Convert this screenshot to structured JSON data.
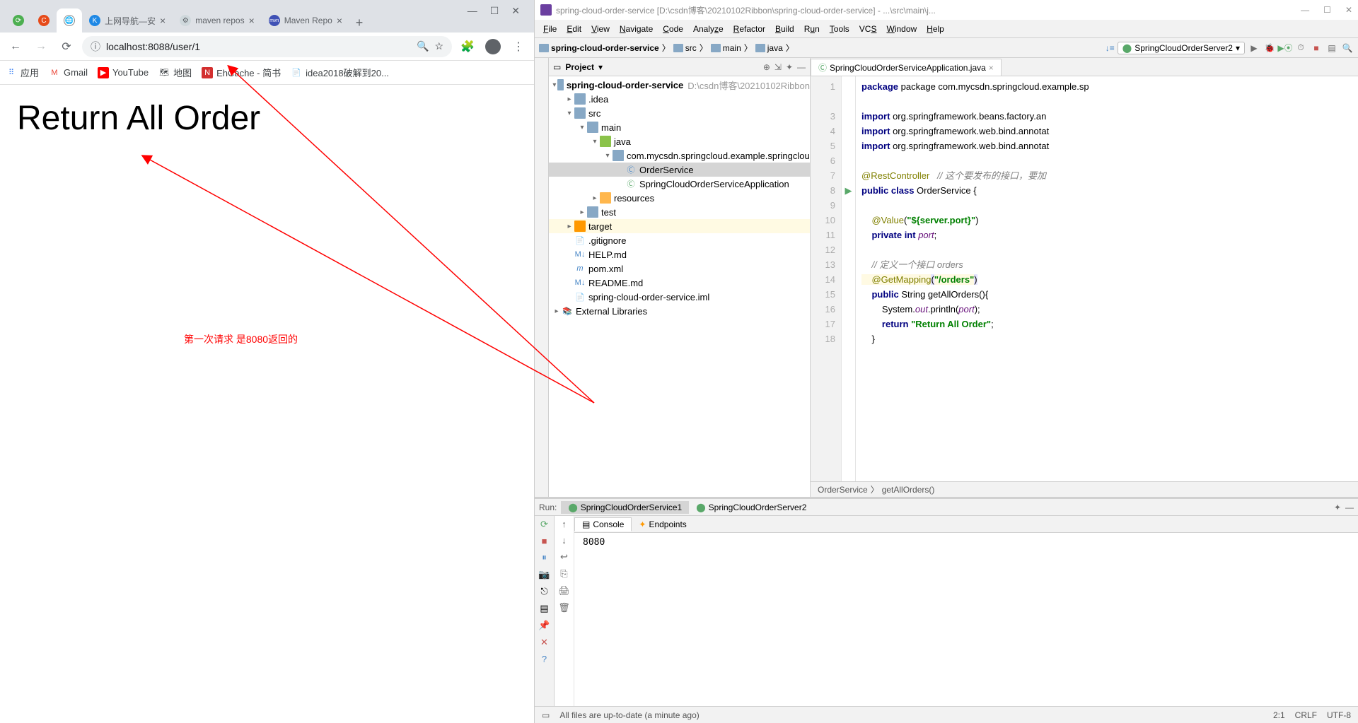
{
  "chrome": {
    "tabs": [
      {
        "label": "",
        "active": false,
        "favcolor": "#4caf50"
      },
      {
        "label": "",
        "active": false,
        "favcolor": "#e64a19",
        "text": "C"
      },
      {
        "label": "",
        "active": true
      },
      {
        "label": "上网导航—安",
        "favcolor": "#1e88e5",
        "text": "K"
      },
      {
        "label": "maven repos",
        "favcolor": "#9e9e9e"
      },
      {
        "label": "Maven Repo",
        "favcolor": "#3f51b5"
      }
    ],
    "url": "localhost:8088/user/1",
    "bookmarks": [
      {
        "label": "应用",
        "color": "#4285f4"
      },
      {
        "label": "Gmail",
        "color": "#ea4335",
        "text": "M"
      },
      {
        "label": "YouTube",
        "color": "#ff0000",
        "text": "▶"
      },
      {
        "label": "地图",
        "color": "#34a853"
      },
      {
        "label": "EhCache - 简书",
        "color": "#d32f2f",
        "text": "N"
      },
      {
        "label": "idea2018破解到20..."
      }
    ],
    "page_heading": "Return All Order",
    "annotation": "第一次请求 是8080返回的"
  },
  "ij": {
    "title": "spring-cloud-order-service [D:\\csdn博客\\20210102Ribbon\\spring-cloud-order-service] - ...\\src\\main\\j...",
    "menu": [
      "File",
      "Edit",
      "View",
      "Navigate",
      "Code",
      "Analyze",
      "Refactor",
      "Build",
      "Run",
      "Tools",
      "VCS",
      "Window",
      "Help"
    ],
    "crumbs": [
      "spring-cloud-order-service",
      "src",
      "main",
      "java"
    ],
    "run_config": "SpringCloudOrderServer2",
    "proj_header": "Project",
    "tree": {
      "root": "spring-cloud-order-service",
      "root_path": "D:\\csdn博客\\20210102Ribbon",
      "idea": ".idea",
      "src": "src",
      "main": "main",
      "java": "java",
      "pkg": "com.mycsdn.springcloud.example.springclou",
      "cls1": "OrderService",
      "cls2": "SpringCloudOrderServiceApplication",
      "resources": "resources",
      "test": "test",
      "target": "target",
      "gitignore": ".gitignore",
      "help": "HELP.md",
      "pom": "pom.xml",
      "readme": "README.md",
      "iml": "spring-cloud-order-service.iml",
      "ext": "External Libraries"
    },
    "editor_tab": "SpringCloudOrderServiceApplication.java",
    "code": {
      "l1": "package com.mycsdn.springcloud.example.sp",
      "l3": "import org.springframework.beans.factory.an",
      "l4": "import org.springframework.web.bind.annotat",
      "l5": "import org.springframework.web.bind.annotat",
      "l7a": "@RestController",
      "l7b": "// 这个要发布的接口，要加",
      "l8": "public class OrderService {",
      "l10a": "@Value",
      "l10b": "\"${server.port}\"",
      "l11": "    private int port;",
      "l13": "// 定义一个接口 orders",
      "l14a": "@GetMapping",
      "l14b": "\"/orders\"",
      "l15": "    public String getAllOrders(){",
      "l16a": "System.",
      "l16b": "out",
      "l16c": ".println(",
      "l16d": "port",
      "l16e": ");",
      "l17a": "return ",
      "l17b": "\"Return All Order\"",
      "l18": "    }"
    },
    "breadcrumb": {
      "cls": "OrderService",
      "method": "getAllOrders()"
    },
    "run": {
      "label": "Run:",
      "tab1": "SpringCloudOrderService1",
      "tab2": "SpringCloudOrderServer2",
      "console": "Console",
      "endpoints": "Endpoints",
      "output": "8080"
    },
    "status": {
      "msg": "All files are up-to-date (a minute ago)",
      "pos": "2:1",
      "sep": "CRLF",
      "enc": "UTF-8"
    }
  }
}
